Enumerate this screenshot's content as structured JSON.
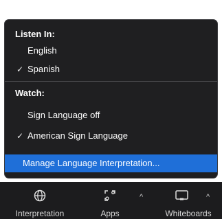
{
  "menu": {
    "listen_heading": "Listen In:",
    "listen_options": [
      {
        "label": "English",
        "checked": false
      },
      {
        "label": "Spanish",
        "checked": true
      }
    ],
    "watch_heading": "Watch:",
    "watch_options": [
      {
        "label": "Sign Language off",
        "checked": false
      },
      {
        "label": "American Sign Language",
        "checked": true
      }
    ],
    "manage_label": "Manage Language Interpretation..."
  },
  "toolbar": {
    "items": [
      {
        "label": "Interpretation",
        "icon": "globe-icon"
      },
      {
        "label": "Apps",
        "icon": "apps-icon"
      },
      {
        "label": "Whiteboards",
        "icon": "whiteboard-icon"
      }
    ]
  },
  "colors": {
    "menu_bg": "#1f1f21",
    "highlight": "#1f6fd8",
    "toolbar_bg": "#1c1c1e"
  }
}
